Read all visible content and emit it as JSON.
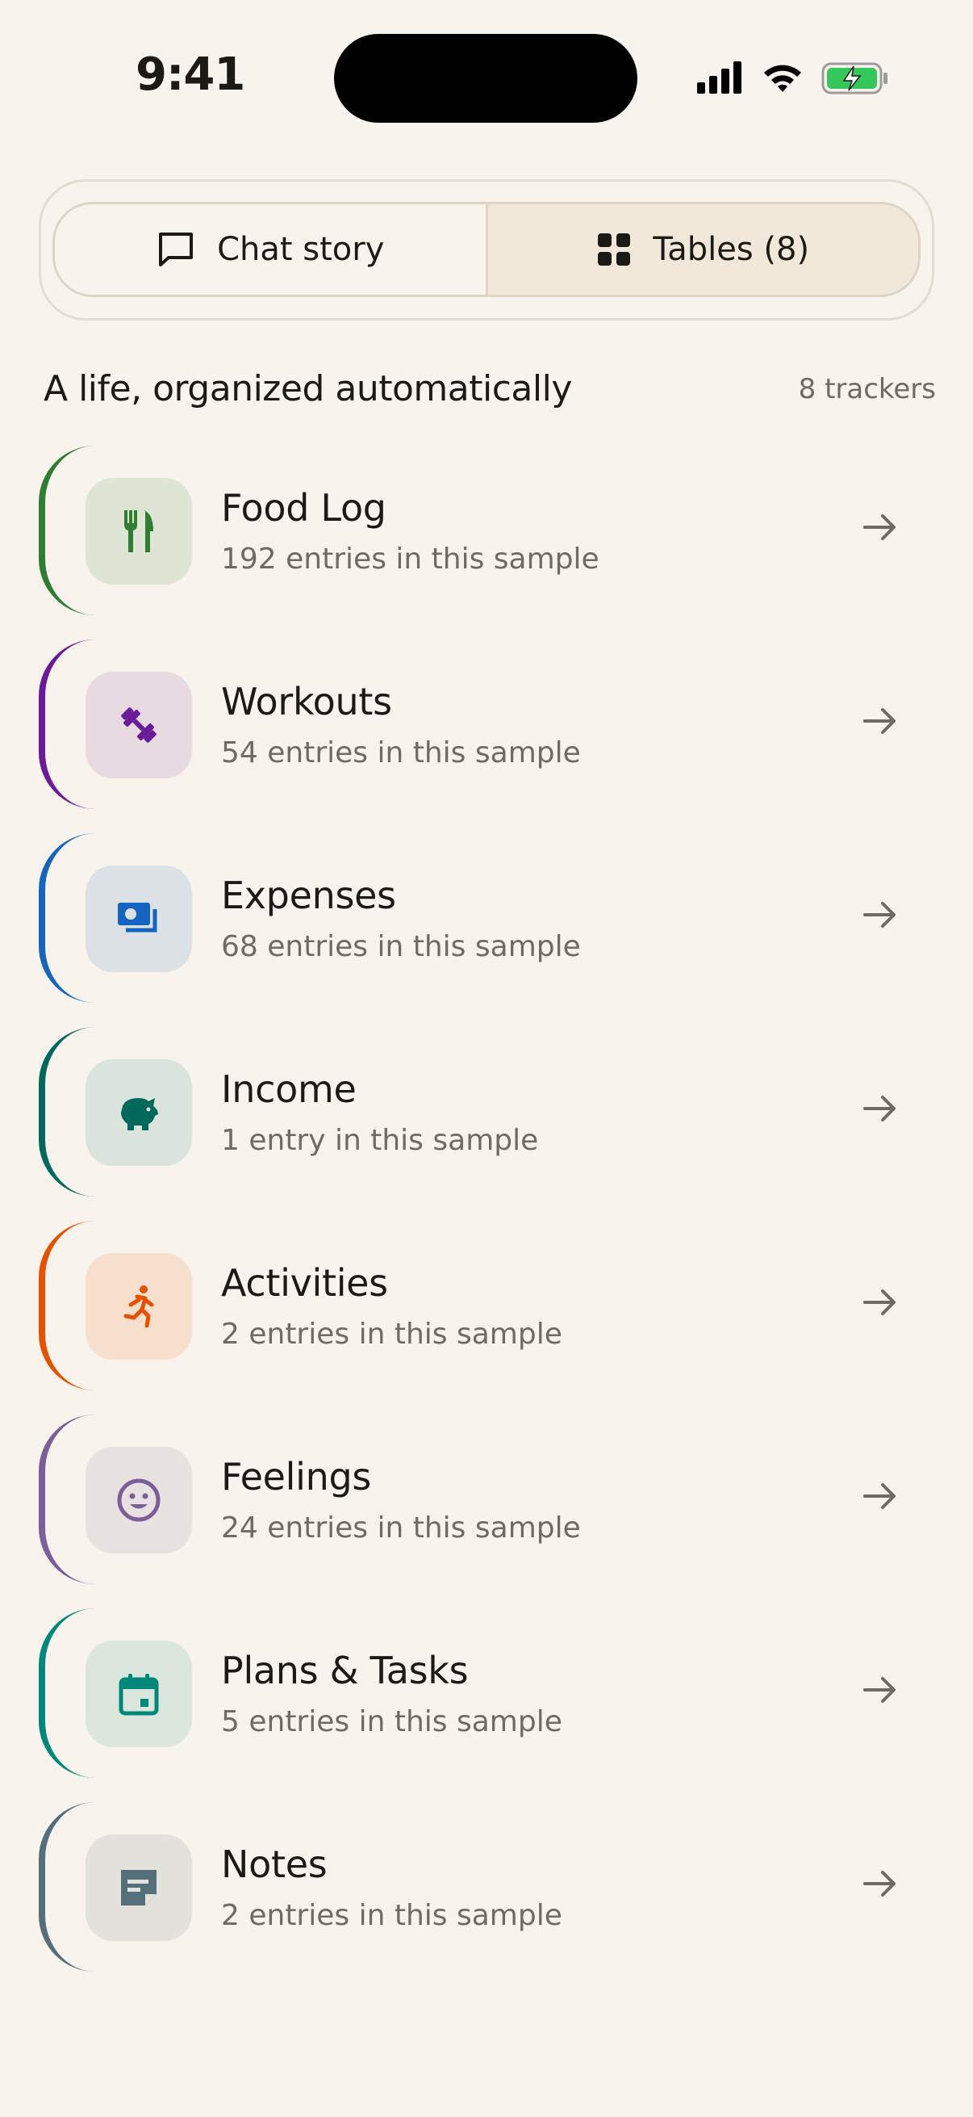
{
  "status_bar": {
    "time": "9:41"
  },
  "tabs": {
    "chat_label": "Chat story",
    "tables_label": "Tables (8)",
    "selected": "tables"
  },
  "section": {
    "title": "A life, organized automatically",
    "count": "8 trackers"
  },
  "trackers": [
    {
      "name": "Food Log",
      "subtitle": "192 entries in this sample",
      "icon": "fork-knife-icon",
      "accent": "#2e7d32",
      "tint": "#dfe5d5"
    },
    {
      "name": "Workouts",
      "subtitle": "54 entries in this sample",
      "icon": "dumbbell-icon",
      "accent": "#6a1b9a",
      "tint": "#e7dae0"
    },
    {
      "name": "Expenses",
      "subtitle": "68 entries in this sample",
      "icon": "cash-icon",
      "accent": "#1565c0",
      "tint": "#dce1e6"
    },
    {
      "name": "Income",
      "subtitle": "1 entry in this sample",
      "icon": "piggy-bank-icon",
      "accent": "#00695c",
      "tint": "#dae3dc"
    },
    {
      "name": "Activities",
      "subtitle": "2 entries in this sample",
      "icon": "running-person-icon",
      "accent": "#e65100",
      "tint": "#f6dfcd"
    },
    {
      "name": "Feelings",
      "subtitle": "24 entries in this sample",
      "icon": "smiley-icon",
      "accent": "#7b5e9a",
      "tint": "#e7e1df"
    },
    {
      "name": "Plans & Tasks",
      "subtitle": "5 entries in this sample",
      "icon": "calendar-icon",
      "accent": "#00897b",
      "tint": "#dbe6dd"
    },
    {
      "name": "Notes",
      "subtitle": "2 entries in this sample",
      "icon": "note-icon",
      "accent": "#546e7a",
      "tint": "#e2e1dc"
    }
  ]
}
